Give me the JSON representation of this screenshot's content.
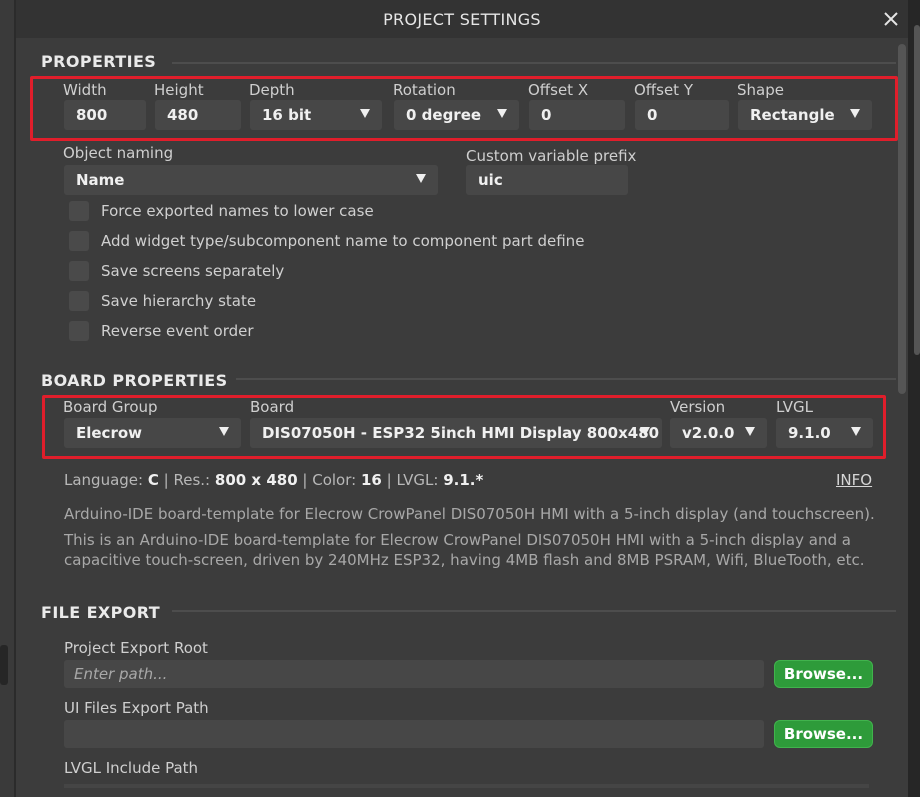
{
  "dialog": {
    "title": "PROJECT SETTINGS"
  },
  "properties": {
    "section_title": "PROPERTIES",
    "width": {
      "label": "Width",
      "value": "800"
    },
    "height": {
      "label": "Height",
      "value": "480"
    },
    "depth": {
      "label": "Depth",
      "value": "16 bit"
    },
    "rotation": {
      "label": "Rotation",
      "value": "0 degree"
    },
    "offset_x": {
      "label": "Offset X",
      "value": "0"
    },
    "offset_y": {
      "label": "Offset Y",
      "value": "0"
    },
    "shape": {
      "label": "Shape",
      "value": "Rectangle"
    },
    "object_naming": {
      "label": "Object naming",
      "value": "Name"
    },
    "custom_prefix": {
      "label": "Custom variable prefix",
      "value": "uic"
    },
    "checkboxes": [
      "Force exported names to lower case",
      "Add widget type/subcomponent name to component part define",
      "Save screens separately",
      "Save hierarchy state",
      "Reverse event order"
    ]
  },
  "board": {
    "section_title": "BOARD PROPERTIES",
    "group": {
      "label": "Board Group",
      "value": "Elecrow"
    },
    "board": {
      "label": "Board",
      "value": "DIS07050H - ESP32 5inch HMI Display 800x480"
    },
    "version": {
      "label": "Version",
      "value": "v2.0.0"
    },
    "lvgl": {
      "label": "LVGL",
      "value": "9.1.0"
    },
    "info": {
      "language_label": "Language:",
      "language": "C",
      "res_label": "Res.:",
      "res": "800 x 480",
      "color_label": "Color:",
      "color": "16",
      "lvgl_label": "LVGL:",
      "lvgl": "9.1.*",
      "info_link": "INFO"
    },
    "short_desc": "Arduino-IDE board-template for Elecrow CrowPanel DIS07050H HMI with a 5-inch display (and touchscreen).",
    "long_desc": "This is an Arduino-IDE board-template for Elecrow CrowPanel DIS07050H HMI with a 5-inch display and a capacitive touch-screen, driven by 240MHz ESP32, having 4MB flash and 8MB PSRAM, Wifi, BlueTooth, etc."
  },
  "file_export": {
    "section_title": "FILE EXPORT",
    "project_root": {
      "label": "Project Export Root",
      "placeholder": "Enter path...",
      "value": ""
    },
    "ui_files": {
      "label": "UI Files Export Path",
      "value": ""
    },
    "lvgl_include": {
      "label": "LVGL Include Path"
    },
    "browse_label": "Browse..."
  },
  "colors": {
    "accent_red": "#e01e2b",
    "browse_green": "#2e9b3a",
    "dialog_bg": "#3c3c3c"
  },
  "icons": {
    "close": "close-icon",
    "dropdown": "chevron-down-icon"
  }
}
